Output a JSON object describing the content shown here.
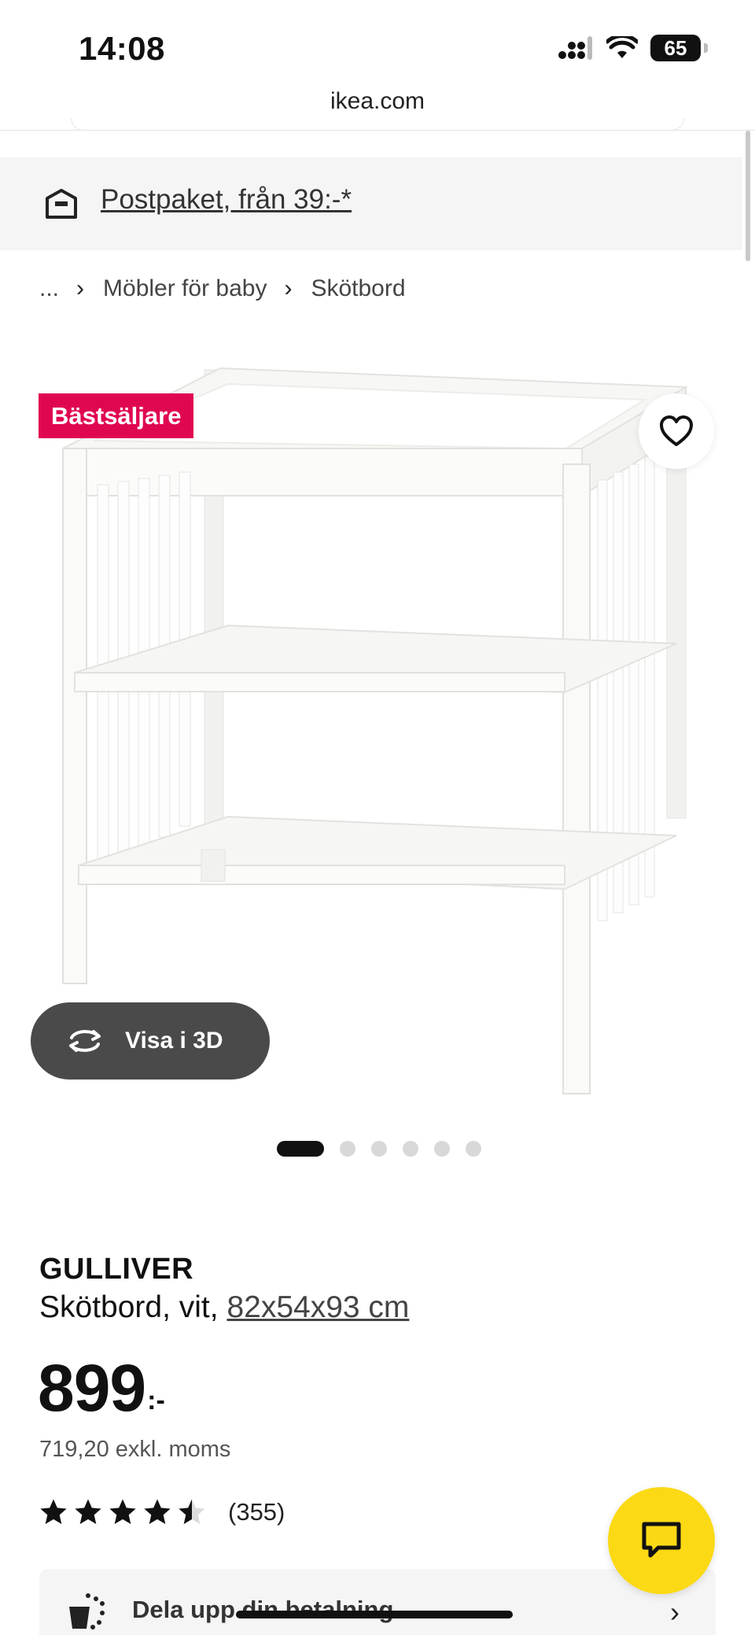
{
  "status_bar": {
    "time": "14:08",
    "battery": "65"
  },
  "browser": {
    "url": "ikea.com"
  },
  "delivery": {
    "text": "Postpaket, från 39:-*",
    "icon": "parcel-icon"
  },
  "breadcrumb": {
    "ellipsis": "...",
    "items": [
      "Möbler för baby",
      "Skötbord"
    ]
  },
  "gallery": {
    "badge": "Bästsäljare",
    "view3d_label": "Visa i 3D",
    "image_count": 6,
    "active_index": 0
  },
  "product": {
    "name": "GULLIVER",
    "description": "Skötbord, vit, ",
    "dimensions": "82x54x93 cm",
    "price": "899",
    "price_suffix": ":-",
    "price_ex_vat": "719,20 exkl. moms",
    "rating": 4.5,
    "review_count": "(355)"
  },
  "installment": {
    "label": "Dela upp din betalning"
  },
  "colors": {
    "badge": "#e00751",
    "chat_button": "#fbd914",
    "banner_bg": "#f5f5f5",
    "view3d_bg": "#4a4a4a"
  }
}
